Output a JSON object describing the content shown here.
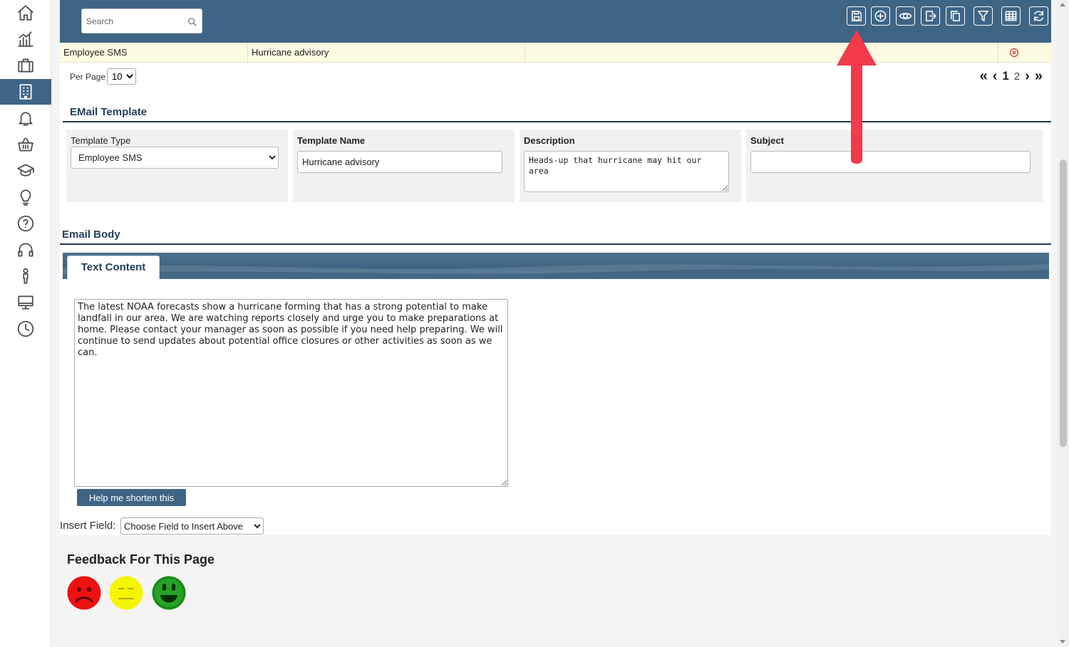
{
  "sidebar": {
    "items": [
      {
        "icon": "home-icon"
      },
      {
        "icon": "analytics-icon"
      },
      {
        "icon": "briefcase-icon"
      },
      {
        "icon": "building-icon",
        "active": true
      },
      {
        "icon": "bell-icon"
      },
      {
        "icon": "basket-icon"
      },
      {
        "icon": "graduation-cap-icon"
      },
      {
        "icon": "lightbulb-icon"
      },
      {
        "icon": "help-icon"
      },
      {
        "icon": "headset-icon"
      },
      {
        "icon": "person-icon"
      },
      {
        "icon": "monitor-icon"
      },
      {
        "icon": "clock-icon"
      }
    ]
  },
  "toolbar": {
    "search_placeholder": "Search",
    "buttons": [
      "save-icon",
      "add-icon",
      "preview-icon",
      "export-icon",
      "copy-icon",
      "filter-icon",
      "grid-icon",
      "refresh-icon"
    ]
  },
  "table": {
    "row": {
      "template_type": "Employee SMS",
      "template_name": "Hurricane advisory",
      "description": ""
    }
  },
  "pagination": {
    "per_page_label": "Per Page",
    "per_page_value": "10",
    "first": "«",
    "prev": "‹",
    "current_page": "1",
    "next_page": "2",
    "next": "›",
    "last": "»"
  },
  "email_template": {
    "title": "EMail Template",
    "template_type_label": "Template Type",
    "template_type_value": "Employee SMS",
    "template_name_label": "Template Name",
    "template_name_value": "Hurricane advisory",
    "description_label": "Description",
    "description_value": "Heads-up that hurricane may hit our area",
    "subject_label": "Subject",
    "subject_value": ""
  },
  "email_body": {
    "title": "Email Body",
    "tab_label": "Text Content",
    "text": "The latest NOAA forecasts show a hurricane forming that has a strong potential to make landfall in our area. We are watching reports closely and urge you to make preparations at home. Please contact your manager as soon as possible if you need help preparing. We will continue to send updates about potential office closures or other activities as soon as we can.",
    "shorten_button": "Help me shorten this",
    "insert_field_label": "Insert Field:",
    "insert_field_value": "Choose Field to Insert Above"
  },
  "feedback": {
    "title": "Feedback For This Page",
    "faces": [
      {
        "name": "sad-face-icon",
        "color": "#ee1111"
      },
      {
        "name": "neutral-face-icon",
        "color": "#f5f500"
      },
      {
        "name": "happy-face-icon",
        "color": "#1a8a1a"
      }
    ]
  },
  "colors": {
    "header": "#3f6586",
    "row_highlight": "#fdfbe2",
    "annotation_arrow": "#f23a4a"
  }
}
